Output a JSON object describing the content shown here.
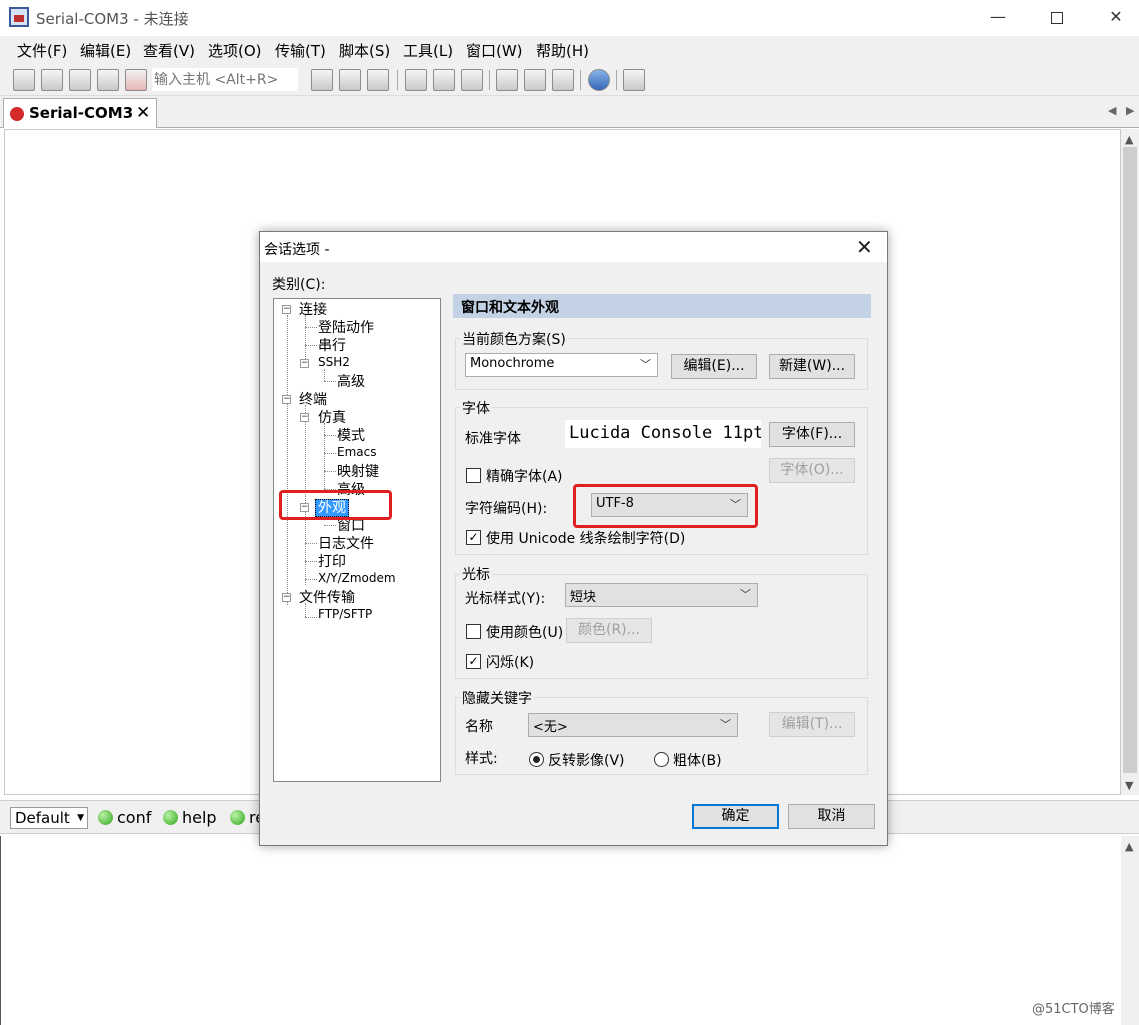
{
  "window": {
    "title": "Serial-COM3 - 未连接",
    "minimize": "—",
    "close": "✕"
  },
  "menu": [
    "文件(F)",
    "编辑(E)",
    "查看(V)",
    "选项(O)",
    "传输(T)",
    "脚本(S)",
    "工具(L)",
    "窗口(W)",
    "帮助(H)"
  ],
  "toolbar": {
    "host_placeholder": "输入主机 <Alt+R>"
  },
  "tab": {
    "label": "Serial-COM3",
    "close": "✕",
    "left_arrow": "◀",
    "right_arrow": "▶"
  },
  "button_bar": {
    "session": "Default",
    "buttons": [
      "conf",
      "help",
      "re"
    ]
  },
  "watermark": "@51CTO博客",
  "dialog": {
    "title": "会话选项 -",
    "close": "✕",
    "category_label": "类别(C):",
    "tree": {
      "connect": "连接",
      "login_actions": "登陆动作",
      "serial": "串行",
      "ssh2": "SSH2",
      "ssh2_advanced": "高级",
      "terminal": "终端",
      "emulation": "仿真",
      "modes": "模式",
      "emacs": "Emacs",
      "mapped_keys": "映射键",
      "emu_advanced": "高级",
      "appearance": "外观",
      "window": "窗口",
      "log_file": "日志文件",
      "print": "打印",
      "xyz_modem": "X/Y/Zmodem",
      "file_transfer": "文件传输",
      "ftp_sftp": "FTP/SFTP"
    },
    "section_header": "窗口和文本外观",
    "color_scheme": {
      "group": "当前颜色方案(S)",
      "value": "Monochrome",
      "edit": "编辑(E)...",
      "new": "新建(W)..."
    },
    "font": {
      "group": "字体",
      "standard_label": "标准字体",
      "preview": "Lucida Console 11pt",
      "font_button": "字体(F)...",
      "font_button2": "字体(O)...",
      "precise_label": "精确字体(A)",
      "precise_checked": false,
      "encoding_label": "字符编码(H):",
      "encoding_value": "UTF-8",
      "unicode_label": "使用 Unicode 线条绘制字符(D)",
      "unicode_checked": true
    },
    "cursor": {
      "group": "光标",
      "style_label": "光标样式(Y):",
      "style_value": "短块",
      "use_color_label": "使用颜色(U)",
      "use_color_checked": false,
      "color_button": "颜色(R)...",
      "blink_label": "闪烁(K)",
      "blink_checked": true
    },
    "keywords": {
      "group": "隐藏关键字",
      "name_label": "名称",
      "name_value": "<无>",
      "edit_button": "编辑(T)...",
      "style_label": "样式:",
      "reverse_label": "反转影像(V)",
      "bold_label": "粗体(B)",
      "selected_style": "reverse"
    },
    "ok": "确定",
    "cancel": "取消"
  },
  "colors": {
    "selection": "#3399ff",
    "header_band": "#c3d3e5",
    "annotation_red": "#e02020",
    "default_button_border": "#0078d7"
  },
  "icons": [
    "app-icon",
    "connect-icon",
    "quick-connect-icon",
    "connect-tab-icon",
    "reconnect-icon",
    "disconnect-icon",
    "copy-icon",
    "paste-icon",
    "find-icon",
    "print-icon",
    "print-setup-icon",
    "printer-icon",
    "session-options-icon",
    "global-options-icon",
    "keymap-icon",
    "help-icon",
    "screen-icon"
  ]
}
